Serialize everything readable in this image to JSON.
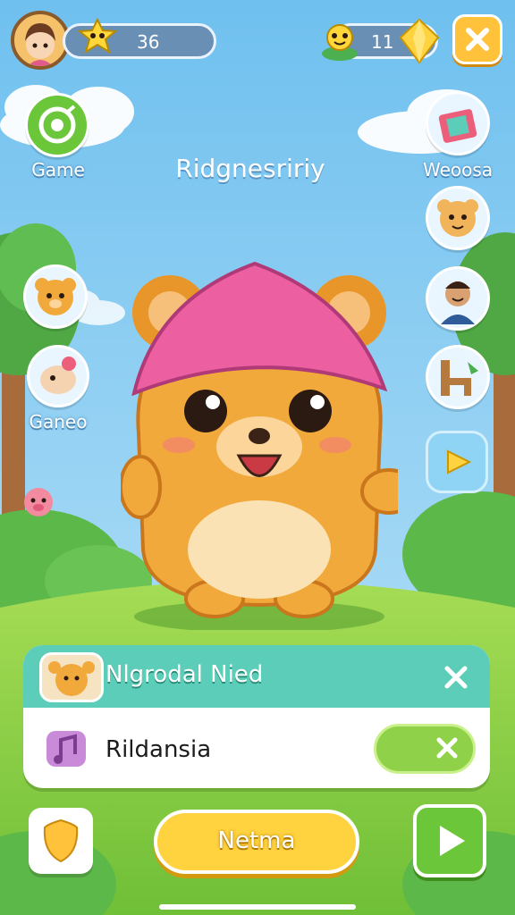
{
  "hud": {
    "hearts_count": "36",
    "gems_count": "11",
    "close_icon": "close-icon"
  },
  "side_menu_left": [
    {
      "label": "Game",
      "icon": "target-icon"
    },
    {
      "label": "",
      "icon": "bear-avatar-icon"
    },
    {
      "label": "Ganeo",
      "icon": "animal-avatar-icon"
    },
    {
      "label": "",
      "icon": "pig-icon"
    }
  ],
  "side_menu_right": [
    {
      "label": "Weoosa",
      "icon": "gift-box-icon"
    },
    {
      "label": "",
      "icon": "hamster-avatar-icon"
    },
    {
      "label": "",
      "icon": "man-avatar-icon"
    },
    {
      "label": "",
      "icon": "chair-icon"
    },
    {
      "label": "",
      "icon": "play-arrow-icon"
    }
  ],
  "scene": {
    "title": "Ridgnesririy"
  },
  "notification": {
    "title": "Nlgrodal Nied",
    "body_text": "Rildansia"
  },
  "bottom_bar": {
    "main_button_label": "Netma"
  },
  "colors": {
    "sky": "#7ec8f2",
    "grass": "#8fd24a",
    "teal_header": "#5ccdb8",
    "yellow_button": "#ffd23f",
    "green_button": "#6cc63a",
    "pet_body": "#f2a93b",
    "pet_hat": "#ec5fa0"
  }
}
